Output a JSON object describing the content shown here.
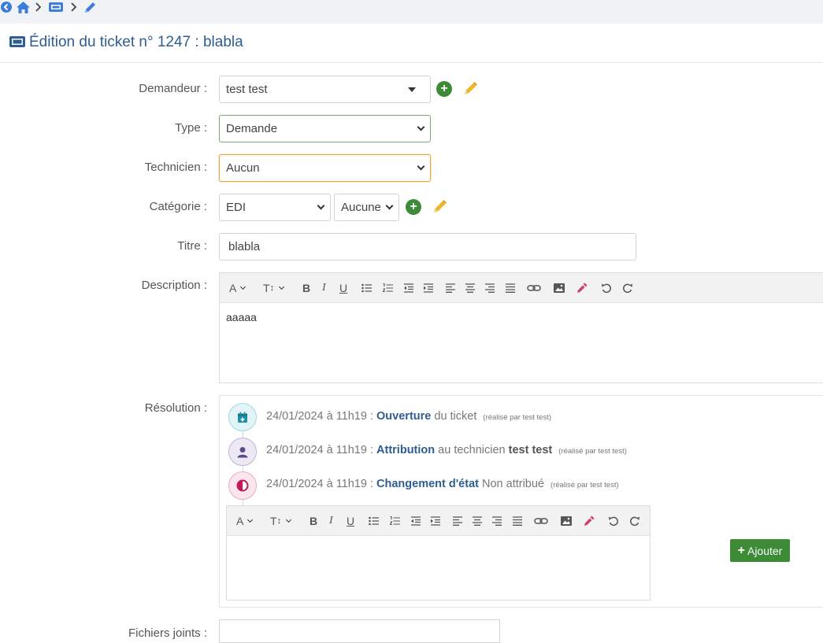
{
  "header": {
    "title": "Édition du ticket n° 1247 : blabla",
    "breadcrumb": [
      "back-icon",
      "home-icon",
      "ticket-icon",
      "pencil-icon"
    ]
  },
  "form": {
    "demandeur": {
      "label": "Demandeur :",
      "value": "test test"
    },
    "type": {
      "label": "Type :",
      "value": "Demande"
    },
    "technicien": {
      "label": "Technicien :",
      "value": "Aucun"
    },
    "categorie": {
      "label": "Catégorie :",
      "value": "EDI",
      "sub_value": "Aucune"
    },
    "titre": {
      "label": "Titre :",
      "value": "blabla"
    },
    "description": {
      "label": "Description :",
      "value": "aaaaa"
    },
    "resolution": {
      "label": "Résolution :"
    },
    "fichiers": {
      "label": "Fichiers joints :"
    }
  },
  "toolbar_buttons": [
    "A",
    "TT",
    "B",
    "I",
    "U",
    "bullet-list",
    "numbered-list",
    "outdent",
    "indent",
    "align-left",
    "align-center",
    "align-right",
    "justify",
    "link",
    "image",
    "eyedropper",
    "undo",
    "redo"
  ],
  "timeline": [
    {
      "date": "24/01/2024 à 11h19 :",
      "action": "Ouverture",
      "rest": "du ticket",
      "who": "(réalisé par test test)",
      "icon": "calendar-plus-icon",
      "color": "#1a8fa6"
    },
    {
      "date": "24/01/2024 à 11h19 :",
      "action": "Attribution",
      "rest": "au technicien",
      "tech": "test test",
      "who": "(réalisé par test test)",
      "icon": "user-icon",
      "color": "#5b4b8a"
    },
    {
      "date": "24/01/2024 à 11h19 :",
      "action": "Changement d'état",
      "rest": "Non attribué",
      "who": "(réalisé par test test)",
      "icon": "half-circle-icon",
      "color": "#c2185b"
    }
  ],
  "buttons": {
    "add_label": "Ajouter"
  },
  "colors": {
    "accent": "#2e5e91",
    "green": "#3d8b37",
    "pencil": "#f0b429",
    "breadcrumb_bg": "#f0f2f5"
  }
}
